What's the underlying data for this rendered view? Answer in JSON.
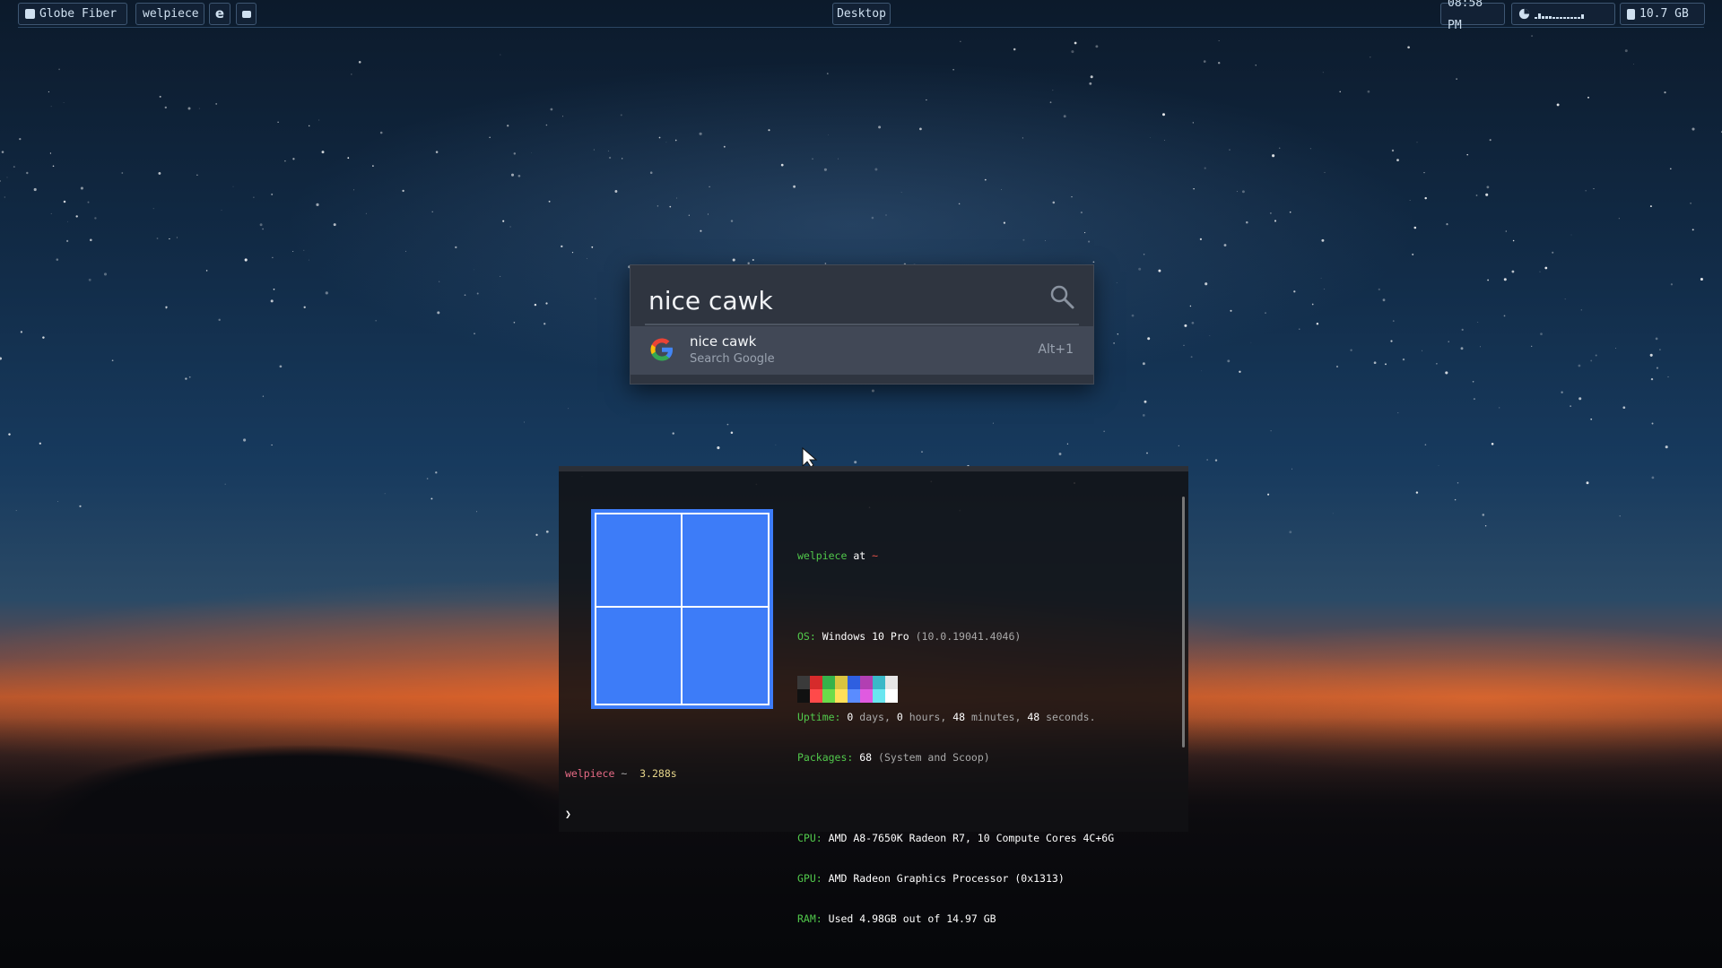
{
  "topbar": {
    "left_items": [
      {
        "label": "Globe Fiber",
        "icon": "network-icon"
      },
      {
        "label": "welpiece",
        "icon": ""
      },
      {
        "label": "",
        "icon": "edge-browser-icon"
      },
      {
        "label": "",
        "icon": "terminal-app-icon"
      }
    ],
    "center_label": "Desktop",
    "clock": "08:58 PM",
    "cpu_icon": "cpu-pie-icon",
    "cpu_graph_levels": [
      0.2,
      0.6,
      0.3,
      0.3,
      0.25,
      0.2,
      0.2,
      0.2,
      0.2,
      0.2,
      0.2,
      0.2,
      0.2,
      0.5
    ],
    "memory_icon": "memory-icon",
    "memory_label": "10.7 GB"
  },
  "launcher": {
    "query": "nice cawk",
    "search_icon": "search-icon",
    "results": [
      {
        "title": "nice cawk",
        "subtitle": "Search Google",
        "shortcut": "Alt+1",
        "icon": "google-icon"
      }
    ]
  },
  "terminal": {
    "user": "welpiece",
    "at": "at",
    "host": "~",
    "os_label": "OS:",
    "os_value": "Windows 10 Pro",
    "os_version": "(10.0.19041.4046)",
    "uptime_label": "Uptime:",
    "uptime": {
      "days": "0",
      "hours": "0",
      "minutes": "48",
      "seconds": "48",
      "w_days": "days,",
      "w_hours": "hours,",
      "w_minutes": "minutes,",
      "w_seconds": "seconds."
    },
    "packages_label": "Packages:",
    "packages_count": "68",
    "packages_note": "(System and Scoop)",
    "cpu_label": "CPU:",
    "cpu_value": "AMD A8-7650K Radeon R7, 10 Compute Cores 4C+6G",
    "gpu_label": "GPU:",
    "gpu_value": "AMD Radeon Graphics Processor (0x1313)",
    "ram_label": "RAM:",
    "ram_value": "Used 4.98GB out of 14.97 GB",
    "palette_top": [
      "#3a3a3a",
      "#d62b2b",
      "#35b24a",
      "#d9c440",
      "#2e5fe0",
      "#b23fb2",
      "#3ab8c8",
      "#e6e6e6"
    ],
    "palette_bottom": [
      "#111111",
      "#ff4a4a",
      "#6bdc4a",
      "#ffe05a",
      "#5a8cff",
      "#e05ae0",
      "#6ae6f0",
      "#ffffff"
    ],
    "prompt_user": "welpiece",
    "prompt_dir": "~",
    "prompt_time": "3.288s",
    "prompt_symbol": "❯",
    "logo_icon": "windows-logo-icon"
  },
  "colors": {
    "accent": "#3d7cf8",
    "label_green": "#51c84b",
    "launcher_bg": "#2f3540"
  }
}
